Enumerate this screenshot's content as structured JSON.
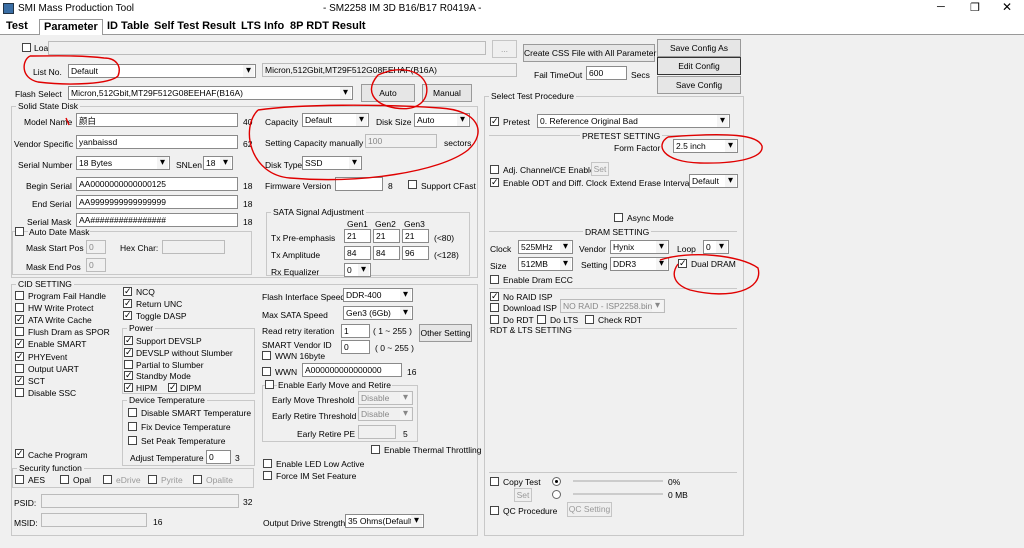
{
  "window": {
    "app_title": "SMI Mass Production Tool",
    "center_title": "- SM2258 IM 3D B16/B17 R0419A -"
  },
  "tabs": [
    "Test",
    "Parameter",
    "ID Table",
    "Self Test Result",
    "LTS Info",
    "8P RDT Result"
  ],
  "top": {
    "load_config_label": "Load Config from",
    "browse_label": "...",
    "list_no_label": "List No.",
    "list_no_value": "Default",
    "flash_info": "Micron,512Gbit,MT29F512G08EEHAF(B16A)",
    "flash_select_label": "Flash Select",
    "flash_select_value": "Micron,512Gbit,MT29F512G08EEHAF(B16A)",
    "auto_label": "Auto",
    "manual_label": "Manual",
    "create_css_label": "Create CSS File with All Parameter",
    "fail_timeout_label": "Fail TimeOut",
    "fail_timeout_value": "600",
    "secs_label": "Secs",
    "save_config_as_label": "Save Config As",
    "edit_config_label": "Edit Config",
    "save_config_label": "Save Config"
  },
  "ssd": {
    "title": "Solid State Disk",
    "model_name_label": "Model Name",
    "model_name_value": "颜白",
    "model_name_len": "40",
    "vendor_specific_label": "Vendor Specific",
    "vendor_specific_value": "yanbaissd",
    "vendor_specific_len": "62",
    "serial_number_label": "Serial Number",
    "serial_number_value": "18 Bytes",
    "snlen_label": "SNLen",
    "snlen_value": "18",
    "begin_serial_label": "Begin Serial",
    "begin_serial_value": "AA0000000000000125",
    "begin_serial_len": "18",
    "end_serial_label": "End Serial",
    "end_serial_value": "AA9999999999999999",
    "end_serial_len": "18",
    "serial_mask_label": "Serial Mask",
    "serial_mask_value": "AA################",
    "serial_mask_len": "18",
    "auto_date_mask_label": "Auto Date Mask",
    "mask_start_label": "Mask Start Pos",
    "mask_start_value": "0",
    "hex_char_label": "Hex Char:",
    "mask_end_label": "Mask End Pos",
    "mask_end_value": "0",
    "capacity_label": "Capacity",
    "capacity_value": "Default",
    "disk_size_label": "Disk Size",
    "disk_size_value": "Auto",
    "setting_cap_label": "Setting Capacity manually",
    "setting_cap_value": "100",
    "sectors_label": "sectors",
    "disk_type_label": "Disk Type",
    "disk_type_value": "SSD",
    "fw_version_label": "Firmware Version",
    "fw_version_len": "8",
    "support_cfast_label": "Support CFast"
  },
  "sata": {
    "title": "SATA Signal Adjustment",
    "gen1": "Gen1",
    "gen2": "Gen2",
    "gen3": "Gen3",
    "tx_pre_label": "Tx Pre-emphasis",
    "tx_pre": [
      "21",
      "21",
      "21"
    ],
    "tx_pre_range": "(<80)",
    "tx_amp_label": "Tx Amplitude",
    "tx_amp": [
      "84",
      "84",
      "96"
    ],
    "tx_amp_range": "(<128)",
    "rx_eq_label": "Rx Equalizer",
    "rx_eq_value": "0"
  },
  "cid": {
    "title": "CID SETTING",
    "col1": [
      {
        "label": "Program Fail Handle",
        "checked": false
      },
      {
        "label": "HW Write Protect",
        "checked": false
      },
      {
        "label": "ATA Write Cache",
        "checked": true
      },
      {
        "label": "Flush Dram as SPOR",
        "checked": false
      },
      {
        "label": "Enable SMART",
        "checked": true
      },
      {
        "label": "PHYEvent",
        "checked": true
      },
      {
        "label": "Output UART",
        "checked": false
      },
      {
        "label": "SCT",
        "checked": true
      },
      {
        "label": "Disable SSC",
        "checked": false
      }
    ],
    "col2": [
      {
        "label": "NCQ",
        "checked": true
      },
      {
        "label": "Return UNC",
        "checked": true
      },
      {
        "label": "Toggle DASP",
        "checked": true
      }
    ],
    "power_title": "Power",
    "power": [
      {
        "label": "Support DEVSLP",
        "checked": true
      },
      {
        "label": "DEVSLP without Slumber",
        "checked": true
      },
      {
        "label": "Partial to Slumber",
        "checked": false
      },
      {
        "label": "Standby Mode",
        "checked": true
      }
    ],
    "hipm_label": "HIPM",
    "dipm_label": "DIPM",
    "devtemp_title": "Device Temperature",
    "devtemp": [
      {
        "label": "Disable SMART Temperature",
        "checked": false
      },
      {
        "label": "Fix Device Temperature",
        "checked": false
      },
      {
        "label": "Set Peak Temperature",
        "checked": false
      }
    ],
    "adjust_temp_label": "Adjust Temperature",
    "adjust_temp_value": "0",
    "adjust_temp_max": "3",
    "cache_program_label": "Cache Program",
    "security_title": "Security function",
    "sec": [
      "AES",
      "Opal",
      "eDrive",
      "Pyrite",
      "Opalite"
    ],
    "psid_label": "PSID:",
    "psid_len": "32",
    "msid_label": "MSID:",
    "msid_len": "16"
  },
  "flash": {
    "interface_label": "Flash Interface Speed",
    "interface_value": "DDR-400",
    "max_sata_label": "Max SATA Speed",
    "max_sata_value": "Gen3 (6Gb)",
    "read_retry_label": "Read retry iteration",
    "read_retry_value": "1",
    "read_retry_range": "( 1 ~ 255 )",
    "other_setting_label": "Other Setting",
    "smart_vendor_label": "SMART Vendor ID",
    "smart_vendor_value": "0",
    "smart_vendor_range": "( 0 ~ 255 )",
    "wwn16_label": "WWN 16byte",
    "wwn_label": "WWN",
    "wwn_value": "A000000000000000",
    "wwn_len": "16",
    "early_move_label": "Enable Early Move and Retire",
    "early_move_th_label": "Early Move Threshold",
    "early_move_th_value": "Disable",
    "early_retire_th_label": "Early Retire Threshold",
    "early_retire_th_value": "Disable",
    "early_retire_pe_label": "Early Retire PE",
    "early_retire_pe_value": "5",
    "thermal_label": "Enable Thermal Throttling",
    "led_label": "Enable LED Low Active",
    "force_im_label": "Force IM Set Feature",
    "output_strength_label": "Output Drive Strength",
    "output_strength_value": "35 Ohms(Default)"
  },
  "right": {
    "procedure_title": "Select Test Procedure",
    "pretest_label": "Pretest",
    "pretest_value": "0. Reference Original Bad",
    "pretest_setting": "PRETEST SETTING",
    "form_factor_label": "Form Factor",
    "form_factor_value": "2.5 inch",
    "adj_channel_label": "Adj. Channel/CE Enable",
    "set_label": "Set",
    "odt_label": "Enable ODT and Diff. Clock",
    "extend_erase_label": "Extend Erase Interval",
    "extend_erase_value": "Default",
    "async_label": "Async Mode",
    "dram_setting": "DRAM SETTING",
    "clock_label": "Clock",
    "clock_value": "525MHz",
    "vendor_label": "Vendor",
    "vendor_value": "Hynix",
    "loop_label": "Loop",
    "loop_value": "0",
    "size_label": "Size",
    "size_value": "512MB",
    "setting_label": "Setting",
    "setting_value": "DDR3",
    "dual_dram_label": "Dual DRAM",
    "dram_ecc_label": "Enable Dram ECC",
    "no_raid_label": "No RAID ISP",
    "download_isp_label": "Download ISP",
    "isp_value": "NO RAID - ISP2258.bin",
    "do_rdt_label": "Do RDT",
    "do_lts_label": "Do LTS",
    "check_rdt_label": "Check RDT",
    "rdt_lts_title": "RDT & LTS SETTING",
    "copy_test_label": "Copy Test",
    "copy_pct": "0%",
    "copy_set_label": "Set",
    "copy_mb": "0 MB",
    "qc_label": "QC Procedure",
    "qc_setting_label": "QC Setting"
  },
  "colors": {
    "annotation": "#e00000"
  }
}
